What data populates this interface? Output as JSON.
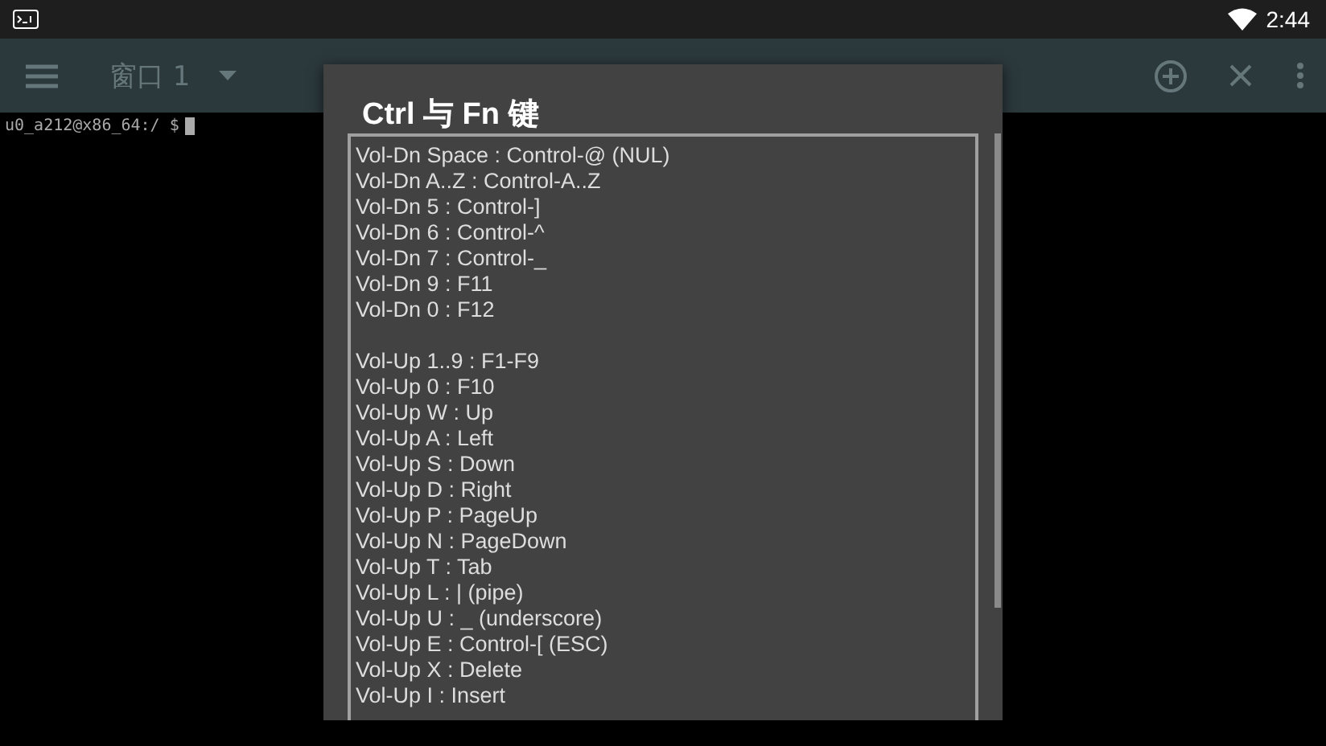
{
  "status_bar": {
    "time": "2:44"
  },
  "toolbar": {
    "window_title": "窗口 1"
  },
  "terminal": {
    "prompt": "u0_a212@x86_64:/ $"
  },
  "dialog": {
    "title": "Ctrl 与 Fn 键",
    "groups": [
      {
        "lines": [
          "Vol-Dn Space : Control-@ (NUL)",
          "Vol-Dn A..Z : Control-A..Z",
          "Vol-Dn 5 : Control-]",
          "Vol-Dn 6 : Control-^",
          "Vol-Dn 7 : Control-_",
          "Vol-Dn 9 : F11",
          "Vol-Dn 0 : F12"
        ]
      },
      {
        "lines": [
          "Vol-Up 1..9 : F1-F9",
          "Vol-Up 0 : F10",
          "Vol-Up W : Up",
          "Vol-Up A : Left",
          "Vol-Up S : Down",
          "Vol-Up D : Right",
          "Vol-Up P : PageUp",
          "Vol-Up N : PageDown",
          "Vol-Up T : Tab",
          "Vol-Up L : | (pipe)",
          "Vol-Up U : _ (underscore)",
          "Vol-Up E : Control-[ (ESC)",
          "Vol-Up X : Delete",
          "Vol-Up I : Insert"
        ]
      }
    ]
  }
}
